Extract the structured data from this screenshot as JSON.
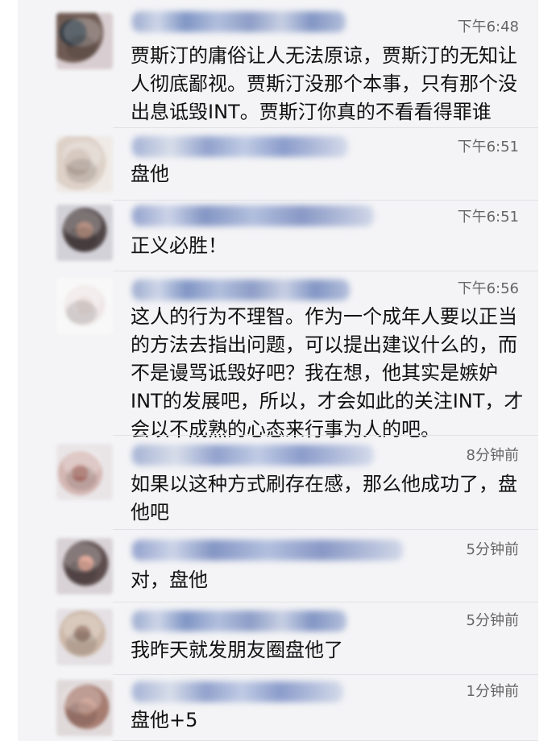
{
  "comments": [
    {
      "time": "下午6:48",
      "name": "",
      "text": "贾斯汀的庸俗让人无法原谅，贾斯汀的无知让\n人彻底鄙视。贾斯汀没那个本事，只有那个没\n出息诋毁INT。贾斯汀你真的不看看得罪谁"
    },
    {
      "time": "下午6:51",
      "name": "",
      "text": "盘他"
    },
    {
      "time": "下午6:51",
      "name": "",
      "text": "正义必胜！"
    },
    {
      "time": "下午6:56",
      "name": "",
      "text": "这人的行为不理智。作为一个成年人要以正当\n的方法去指出问题，可以提出建议什么的，而\n不是谩骂诋毁好吧？我在想，他其实是嫉妒\nINT的发展吧，所以，才会如此的关注INT，才\n会以不成熟的心态来行事为人的吧。"
    },
    {
      "time": "8分钟前",
      "name": "",
      "text": "如果以这种方式刷存在感，那么他成功了，盘\n他吧"
    },
    {
      "time": "5分钟前",
      "name": "",
      "text": "对，盘他"
    },
    {
      "time": "5分钟前",
      "name": "",
      "text": "我昨天就发朋友圈盘他了"
    },
    {
      "time": "1分钟前",
      "name": "",
      "text": "盘他+5"
    }
  ]
}
